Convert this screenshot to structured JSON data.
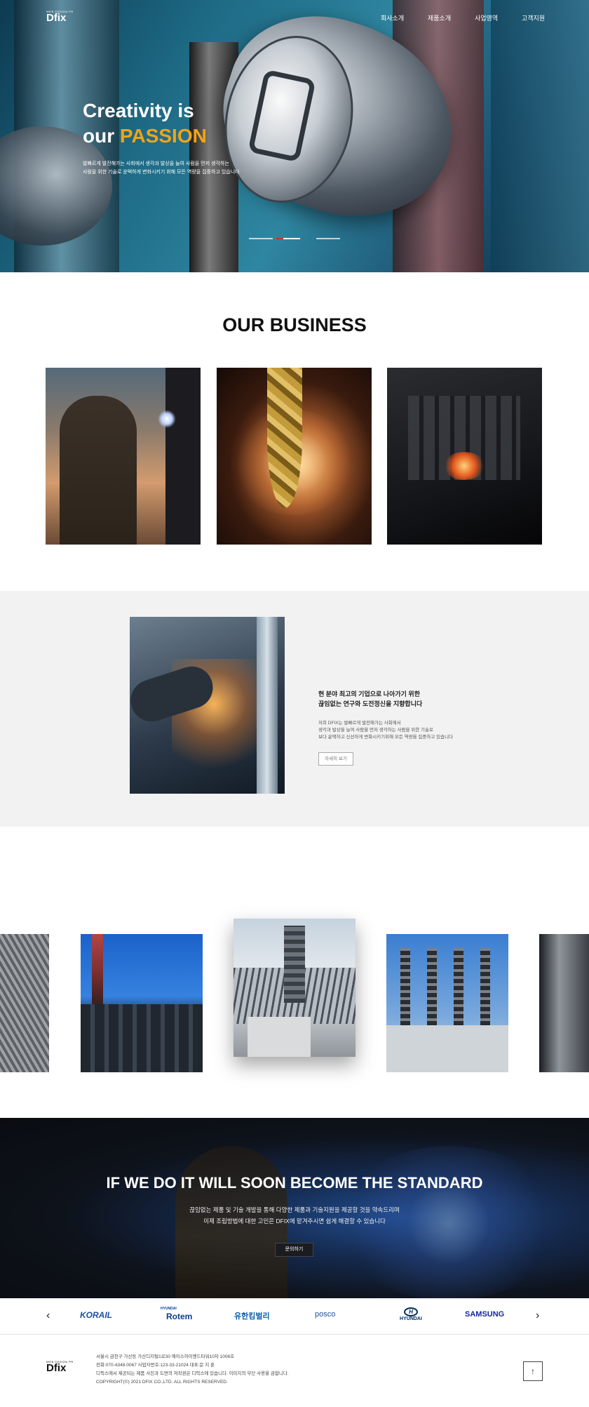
{
  "header": {
    "logo_tag": "WEB DESIGN PR",
    "logo_mark": "Dfix",
    "menu": [
      "회사소개",
      "제품소개",
      "사업영역",
      "고객지원"
    ]
  },
  "hero": {
    "title_line1": "Creativity is",
    "title_line2_prefix": "our ",
    "title_accent": "PASSION",
    "desc_line1": "발빠르게 발전해가는 사회에서 생각과 발상을 늘여 사람을 먼저 생각하는",
    "desc_line2": "사람을 위한 기술로 윤택하게 변화시키기 위해 모든 역량을 집중하고 있습니다",
    "slides": 3,
    "active_slide": 2,
    "accent_color": "#f2a316"
  },
  "business": {
    "title": "OUR BUSINESS",
    "images": [
      "welder-image",
      "drill-sparks-image",
      "foundry-image"
    ]
  },
  "about": {
    "heading_line1": "현 분야 최고의 기업으로 나아가기 위한",
    "heading_line2": "끊임없는 연구와 도전정신을 지향합니다",
    "text_line1": "저희 DFIX는 발빠르게 발전해가는 사회에서",
    "text_line2": "생각과 발상을 늘여 사람을 먼저 생각하는 사람을 위한 기술로",
    "text_line3": "보다 윤택하고 신선하게 변화시키기위해 모든 역량을 집중하고 있습니다",
    "button": "자세히 보기"
  },
  "carousel": {
    "items": [
      "pipes-image",
      "refinery-image",
      "building-image",
      "substation-image",
      "vehicle-image"
    ],
    "active_item": 3
  },
  "cta": {
    "title": "IF WE DO IT WILL SOON BECOME THE STANDARD",
    "text_line1": "끊임없는 제품 및 기술 개발을 통해 다양한 제품과 기술지원을 제공할 것을 약속드리며",
    "text_line2": "이제 조립방법에 대한 고민은 DFIX에 맡겨주시면 쉽게 해결할 수 있습니다",
    "button": "문의하기"
  },
  "partners": {
    "prev": "‹",
    "next": "›",
    "korail": "KORAIL",
    "rotem_top": "HYUNDAI",
    "rotem": "Rotem",
    "yuhan": "유한킴벌리",
    "posco": "posco",
    "hyundai_mark": "H",
    "hyundai": "HYUNDAI",
    "samsung": "SAMSUNG",
    "colors": {
      "korail": "#1b4fa3",
      "rotem": "#0a3d91",
      "yuhan": "#0d5ea8",
      "posco": "#1c4e9c",
      "samsung": "#1428a0"
    }
  },
  "footer": {
    "address": "서울시 금천구 가산동 가산디지털1로30 에이스하이엔드타워10차 1006호",
    "contact": "전화:070-4348-0067 사업자번호:123-33-21024 대표:문 지 훈",
    "notice": "디픽스에서 제공되는 제품 사진과 도면의 저작권은 디픽스에 있습니다. 이미지의 무단 사용을 금합니다.",
    "copyright": "COPYRIGHT(©) 2021 DFIX CO.,LTD. ALL RIGHTS RESERVED.",
    "top_button": "↑"
  }
}
